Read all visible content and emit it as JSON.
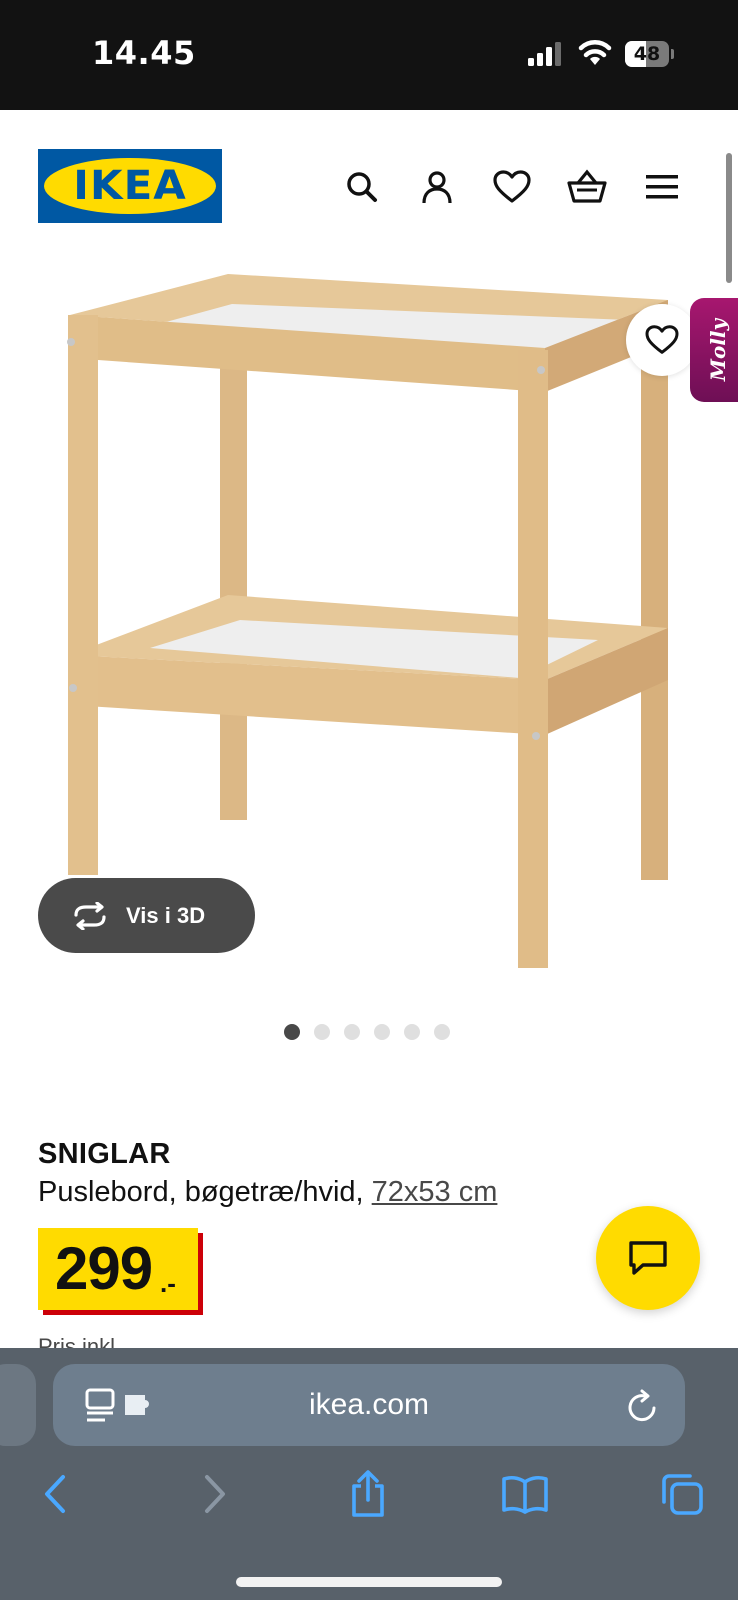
{
  "status_bar": {
    "time": "14.45",
    "battery_level": "48",
    "battery_fraction": 0.48,
    "icons": [
      "signal-icon",
      "wifi-icon",
      "battery-icon"
    ]
  },
  "header": {
    "logo_text": "IKEA",
    "brand_colors": {
      "blue": "#0058a3",
      "yellow": "#ffdb00"
    },
    "nav_icons": [
      "search-icon",
      "account-icon",
      "heart-icon",
      "basket-icon",
      "menu-icon"
    ]
  },
  "gallery": {
    "favorite_icon": "heart-icon",
    "assistant_tab": "Molly",
    "view_3d_label": "Vis i 3D",
    "image_count": 6,
    "active_index": 0
  },
  "product": {
    "name": "SNIGLAR",
    "description": "Puslebord, bøgetræ/hvid, ",
    "size": "72x53 cm",
    "price": "299",
    "price_suffix": ".-",
    "price_colors": {
      "face": "#ffdb00",
      "shadow": "#cc0008"
    },
    "cutoff_text": "Pris inkl."
  },
  "chat": {
    "icon": "chat-icon",
    "color": "#ffdb00"
  },
  "browser": {
    "url": "ikea.com",
    "toolbar_icons": [
      "back-icon",
      "forward-icon",
      "share-icon",
      "bookmarks-icon",
      "tabs-icon"
    ]
  }
}
